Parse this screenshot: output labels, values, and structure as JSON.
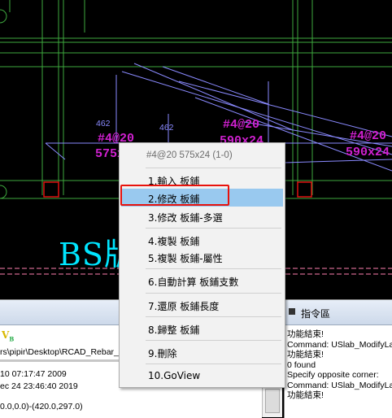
{
  "cad": {
    "labels": [
      {
        "text": "#4@20"
      },
      {
        "text": "575x"
      },
      {
        "text": "462"
      },
      {
        "text": "462"
      },
      {
        "text": "#4@20"
      },
      {
        "text": "590x24"
      },
      {
        "text": "#4@20"
      },
      {
        "text": "590x24"
      }
    ],
    "big_label": "BS版"
  },
  "context_menu": {
    "header": "#4@20 575x24 (1-0)",
    "items": [
      {
        "label": "1.輸入 板鋪"
      },
      {
        "label": "2.修改 板鋪"
      },
      {
        "label": "3.修改 板鋪-多選"
      },
      {
        "label": "4.複製 板鋪"
      },
      {
        "label": "5.複製 板鋪-屬性"
      },
      {
        "label": "6.自動計算 板鋪支數"
      },
      {
        "label": "7.還原 板鋪長度"
      },
      {
        "label": "8.歸整 板鋪"
      },
      {
        "label": "9.刪除"
      },
      {
        "label": "10.GoView"
      }
    ]
  },
  "left_panel": {
    "path": "rs\\pipir\\Desktop\\RCAD_Rebar_",
    "lines": [
      "10 07:17:47 2009",
      "ec 24 23:46:40 2019",
      "0.0,0.0)-(420.0,297.0)"
    ]
  },
  "command_panel": {
    "title": "指令區",
    "log": [
      "功能結束!",
      "Command: USlab_ModifyLa",
      "功能結束!",
      "0 found",
      "Specify opposite corner:",
      "Command: USlab_ModifyLa",
      "功能結束!"
    ]
  },
  "colors": {
    "menu_highlight": "#99c9ef",
    "annotation_box": "#e8120c",
    "cad_background": "#000000"
  }
}
